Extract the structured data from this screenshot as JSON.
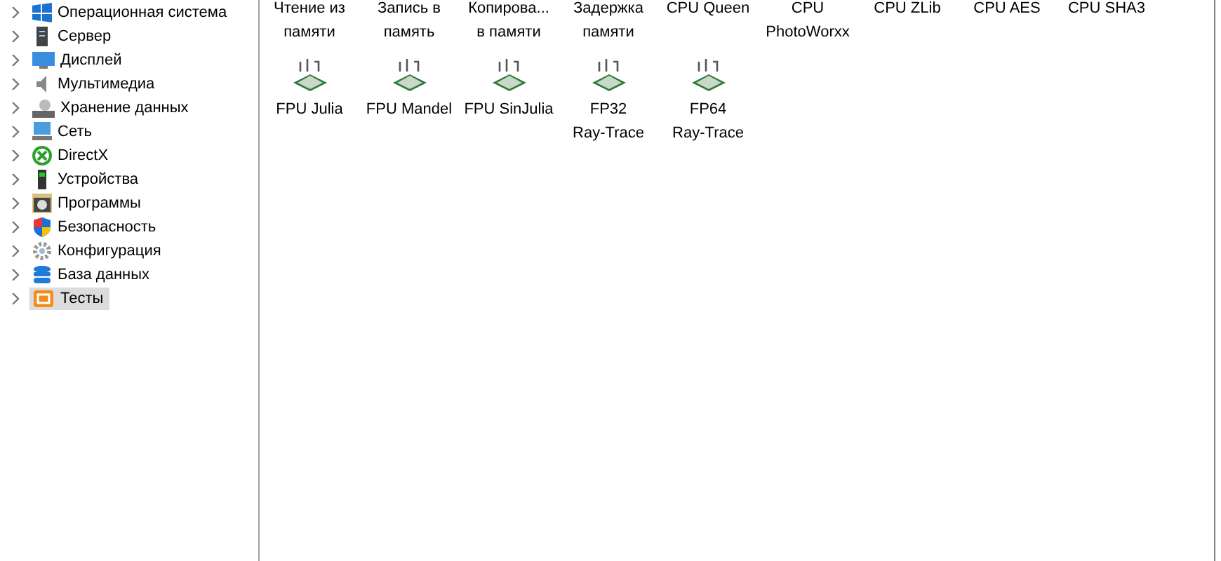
{
  "tree": [
    {
      "label": "Операционная система",
      "expanded": false,
      "selected": false
    },
    {
      "label": "Сервер",
      "expanded": false,
      "selected": false
    },
    {
      "label": "Дисплей",
      "expanded": false,
      "selected": false
    },
    {
      "label": "Мультимедиа",
      "expanded": false,
      "selected": false
    },
    {
      "label": "Хранение данных",
      "expanded": false,
      "selected": false
    },
    {
      "label": "Сеть",
      "expanded": false,
      "selected": false
    },
    {
      "label": "DirectX",
      "expanded": false,
      "selected": false
    },
    {
      "label": "Устройства",
      "expanded": false,
      "selected": false
    },
    {
      "label": "Программы",
      "expanded": false,
      "selected": false
    },
    {
      "label": "Безопасность",
      "expanded": false,
      "selected": false
    },
    {
      "label": "Конфигурация",
      "expanded": false,
      "selected": false
    },
    {
      "label": "База данных",
      "expanded": false,
      "selected": false
    },
    {
      "label": "Тесты",
      "expanded": false,
      "selected": true
    }
  ],
  "benchmarks": [
    {
      "lines": [
        "Чтение из",
        "памяти"
      ],
      "icon_visible": false
    },
    {
      "lines": [
        "Запись в",
        "память"
      ],
      "icon_visible": false
    },
    {
      "lines": [
        "Копирова...",
        "в памяти"
      ],
      "icon_visible": false
    },
    {
      "lines": [
        "Задержка",
        "памяти"
      ],
      "icon_visible": false
    },
    {
      "lines": [
        "CPU Queen"
      ],
      "icon_visible": false
    },
    {
      "lines": [
        "CPU",
        "PhotoWorxx"
      ],
      "icon_visible": false
    },
    {
      "lines": [
        "CPU ZLib"
      ],
      "icon_visible": false
    },
    {
      "lines": [
        "CPU AES"
      ],
      "icon_visible": false
    },
    {
      "lines": [
        "CPU SHA3"
      ],
      "icon_visible": false
    },
    {
      "lines": [
        "FPU Julia"
      ],
      "icon_visible": true
    },
    {
      "lines": [
        "FPU Mandel"
      ],
      "icon_visible": true
    },
    {
      "lines": [
        "FPU SinJulia"
      ],
      "icon_visible": true
    },
    {
      "lines": [
        "FP32",
        "Ray-Trace"
      ],
      "icon_visible": true
    },
    {
      "lines": [
        "FP64",
        "Ray-Trace"
      ],
      "icon_visible": true
    }
  ]
}
